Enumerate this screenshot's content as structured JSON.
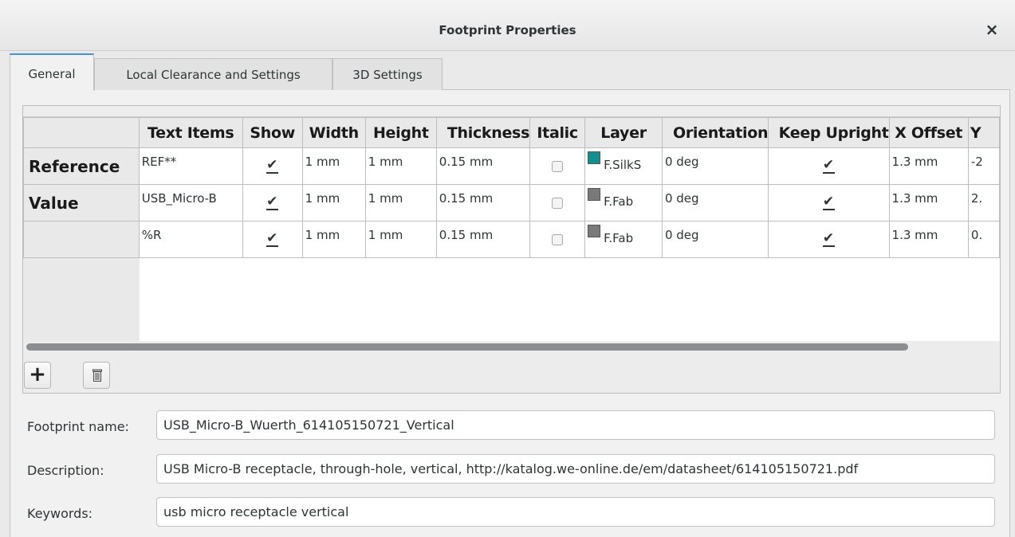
{
  "window": {
    "title": "Footprint Properties",
    "close_glyph": "×"
  },
  "tabs": [
    {
      "label": "General",
      "active": true
    },
    {
      "label": "Local Clearance and Settings",
      "active": false
    },
    {
      "label": "3D Settings",
      "active": false
    }
  ],
  "grid": {
    "columns": [
      "Text Items",
      "Show",
      "Width",
      "Height",
      "Thickness",
      "Italic",
      "Layer",
      "Orientation",
      "Keep Upright",
      "X Offset",
      "Y"
    ],
    "rows": [
      {
        "header": "Reference",
        "text": "REF**",
        "show": true,
        "width": "1 mm",
        "height": "1 mm",
        "thickness": "0.15 mm",
        "italic": false,
        "layer": "F.SilkS",
        "layer_color": "#148f8f",
        "orientation": "0 deg",
        "keep_upright": true,
        "x_offset": "1.3 mm",
        "y_offset": "-2"
      },
      {
        "header": "Value",
        "text": "USB_Micro-B",
        "show": true,
        "width": "1 mm",
        "height": "1 mm",
        "thickness": "0.15 mm",
        "italic": false,
        "layer": "F.Fab",
        "layer_color": "#7a7a7a",
        "orientation": "0 deg",
        "keep_upright": true,
        "x_offset": "1.3 mm",
        "y_offset": "2."
      },
      {
        "header": "",
        "text": "%R",
        "show": true,
        "width": "1 mm",
        "height": "1 mm",
        "thickness": "0.15 mm",
        "italic": false,
        "layer": "F.Fab",
        "layer_color": "#7a7a7a",
        "orientation": "0 deg",
        "keep_upright": true,
        "x_offset": "1.3 mm",
        "y_offset": "0."
      }
    ]
  },
  "buttons": {
    "add": "+",
    "delete_icon": "trash-icon"
  },
  "fields": {
    "footprint_name": {
      "label": "Footprint name:",
      "value": "USB_Micro-B_Wuerth_614105150721_Vertical"
    },
    "description": {
      "label": "Description:",
      "value": "USB Micro-B receptacle, through-hole, vertical, http://katalog.we-online.de/em/datasheet/614105150721.pdf"
    },
    "keywords": {
      "label": "Keywords:",
      "value": "usb micro receptacle vertical"
    }
  }
}
